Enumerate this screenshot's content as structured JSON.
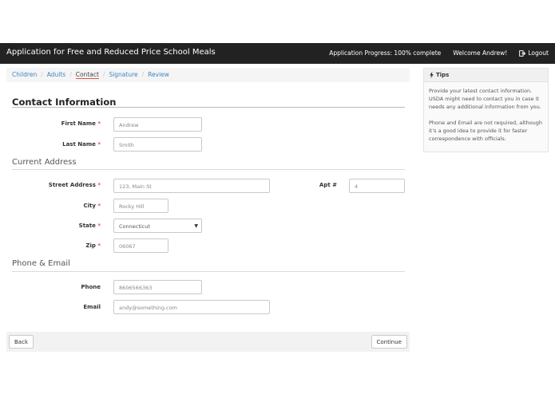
{
  "header": {
    "title": "Application for Free and Reduced Price School Meals",
    "progress": "Application Progress: 100% complete",
    "welcome": "Welcome Andrew!",
    "logout": "Logout"
  },
  "breadcrumb": {
    "items": [
      "Children",
      "Adults",
      "Contact",
      "Signature",
      "Review"
    ],
    "active": "Contact"
  },
  "section": {
    "title": "Contact Information"
  },
  "form": {
    "first_name": {
      "label": "First Name",
      "value": "Andrew"
    },
    "last_name": {
      "label": "Last Name",
      "value": "Smith"
    },
    "address_title": "Current Address",
    "street": {
      "label": "Street Address",
      "value": "123, Main St"
    },
    "apt": {
      "label": "Apt #",
      "value": "4"
    },
    "city": {
      "label": "City",
      "value": "Rocky Hill"
    },
    "state": {
      "label": "State",
      "value": "Connecticut"
    },
    "zip": {
      "label": "Zip",
      "value": "06067"
    },
    "phone_email_title": "Phone & Email",
    "phone": {
      "label": "Phone",
      "value": "8606566363"
    },
    "email": {
      "label": "Email",
      "value": "andy@something.com"
    },
    "required_mark": "*"
  },
  "buttons": {
    "back": "Back",
    "continue": "Continue"
  },
  "tips": {
    "title": "Tips",
    "paragraph1": "Provide your latest contact information. USDA might need to contact you in case it needs any additional information from you.",
    "paragraph2": "Phone and Email are not required, although it's a good idea to provide it for faster correspondence with officials."
  },
  "colors": {
    "navbar": "#222222",
    "link": "#3a87c8",
    "required": "#d9534f"
  },
  "icons": {
    "logout": "logout-icon",
    "tips": "lightning-icon"
  }
}
